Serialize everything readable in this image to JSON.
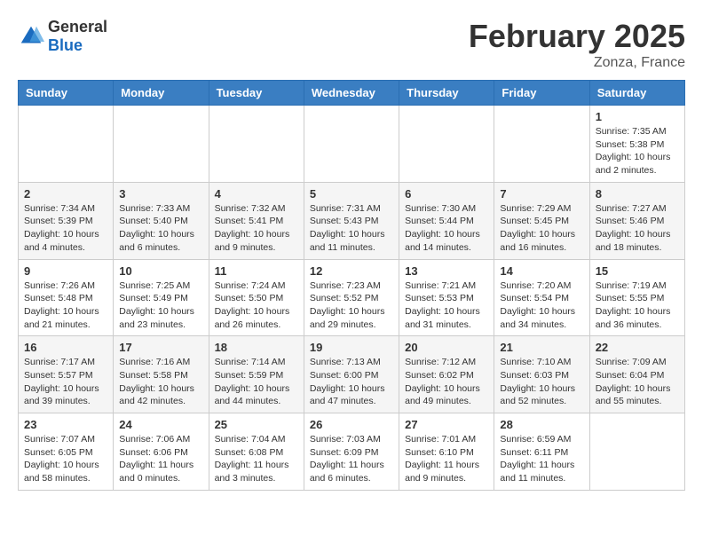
{
  "header": {
    "logo_general": "General",
    "logo_blue": "Blue",
    "month_year": "February 2025",
    "location": "Zonza, France"
  },
  "days_of_week": [
    "Sunday",
    "Monday",
    "Tuesday",
    "Wednesday",
    "Thursday",
    "Friday",
    "Saturday"
  ],
  "weeks": [
    [
      {
        "day": "",
        "info": ""
      },
      {
        "day": "",
        "info": ""
      },
      {
        "day": "",
        "info": ""
      },
      {
        "day": "",
        "info": ""
      },
      {
        "day": "",
        "info": ""
      },
      {
        "day": "",
        "info": ""
      },
      {
        "day": "1",
        "info": "Sunrise: 7:35 AM\nSunset: 5:38 PM\nDaylight: 10 hours\nand 2 minutes."
      }
    ],
    [
      {
        "day": "2",
        "info": "Sunrise: 7:34 AM\nSunset: 5:39 PM\nDaylight: 10 hours\nand 4 minutes."
      },
      {
        "day": "3",
        "info": "Sunrise: 7:33 AM\nSunset: 5:40 PM\nDaylight: 10 hours\nand 6 minutes."
      },
      {
        "day": "4",
        "info": "Sunrise: 7:32 AM\nSunset: 5:41 PM\nDaylight: 10 hours\nand 9 minutes."
      },
      {
        "day": "5",
        "info": "Sunrise: 7:31 AM\nSunset: 5:43 PM\nDaylight: 10 hours\nand 11 minutes."
      },
      {
        "day": "6",
        "info": "Sunrise: 7:30 AM\nSunset: 5:44 PM\nDaylight: 10 hours\nand 14 minutes."
      },
      {
        "day": "7",
        "info": "Sunrise: 7:29 AM\nSunset: 5:45 PM\nDaylight: 10 hours\nand 16 minutes."
      },
      {
        "day": "8",
        "info": "Sunrise: 7:27 AM\nSunset: 5:46 PM\nDaylight: 10 hours\nand 18 minutes."
      }
    ],
    [
      {
        "day": "9",
        "info": "Sunrise: 7:26 AM\nSunset: 5:48 PM\nDaylight: 10 hours\nand 21 minutes."
      },
      {
        "day": "10",
        "info": "Sunrise: 7:25 AM\nSunset: 5:49 PM\nDaylight: 10 hours\nand 23 minutes."
      },
      {
        "day": "11",
        "info": "Sunrise: 7:24 AM\nSunset: 5:50 PM\nDaylight: 10 hours\nand 26 minutes."
      },
      {
        "day": "12",
        "info": "Sunrise: 7:23 AM\nSunset: 5:52 PM\nDaylight: 10 hours\nand 29 minutes."
      },
      {
        "day": "13",
        "info": "Sunrise: 7:21 AM\nSunset: 5:53 PM\nDaylight: 10 hours\nand 31 minutes."
      },
      {
        "day": "14",
        "info": "Sunrise: 7:20 AM\nSunset: 5:54 PM\nDaylight: 10 hours\nand 34 minutes."
      },
      {
        "day": "15",
        "info": "Sunrise: 7:19 AM\nSunset: 5:55 PM\nDaylight: 10 hours\nand 36 minutes."
      }
    ],
    [
      {
        "day": "16",
        "info": "Sunrise: 7:17 AM\nSunset: 5:57 PM\nDaylight: 10 hours\nand 39 minutes."
      },
      {
        "day": "17",
        "info": "Sunrise: 7:16 AM\nSunset: 5:58 PM\nDaylight: 10 hours\nand 42 minutes."
      },
      {
        "day": "18",
        "info": "Sunrise: 7:14 AM\nSunset: 5:59 PM\nDaylight: 10 hours\nand 44 minutes."
      },
      {
        "day": "19",
        "info": "Sunrise: 7:13 AM\nSunset: 6:00 PM\nDaylight: 10 hours\nand 47 minutes."
      },
      {
        "day": "20",
        "info": "Sunrise: 7:12 AM\nSunset: 6:02 PM\nDaylight: 10 hours\nand 49 minutes."
      },
      {
        "day": "21",
        "info": "Sunrise: 7:10 AM\nSunset: 6:03 PM\nDaylight: 10 hours\nand 52 minutes."
      },
      {
        "day": "22",
        "info": "Sunrise: 7:09 AM\nSunset: 6:04 PM\nDaylight: 10 hours\nand 55 minutes."
      }
    ],
    [
      {
        "day": "23",
        "info": "Sunrise: 7:07 AM\nSunset: 6:05 PM\nDaylight: 10 hours\nand 58 minutes."
      },
      {
        "day": "24",
        "info": "Sunrise: 7:06 AM\nSunset: 6:06 PM\nDaylight: 11 hours\nand 0 minutes."
      },
      {
        "day": "25",
        "info": "Sunrise: 7:04 AM\nSunset: 6:08 PM\nDaylight: 11 hours\nand 3 minutes."
      },
      {
        "day": "26",
        "info": "Sunrise: 7:03 AM\nSunset: 6:09 PM\nDaylight: 11 hours\nand 6 minutes."
      },
      {
        "day": "27",
        "info": "Sunrise: 7:01 AM\nSunset: 6:10 PM\nDaylight: 11 hours\nand 9 minutes."
      },
      {
        "day": "28",
        "info": "Sunrise: 6:59 AM\nSunset: 6:11 PM\nDaylight: 11 hours\nand 11 minutes."
      },
      {
        "day": "",
        "info": ""
      }
    ]
  ]
}
